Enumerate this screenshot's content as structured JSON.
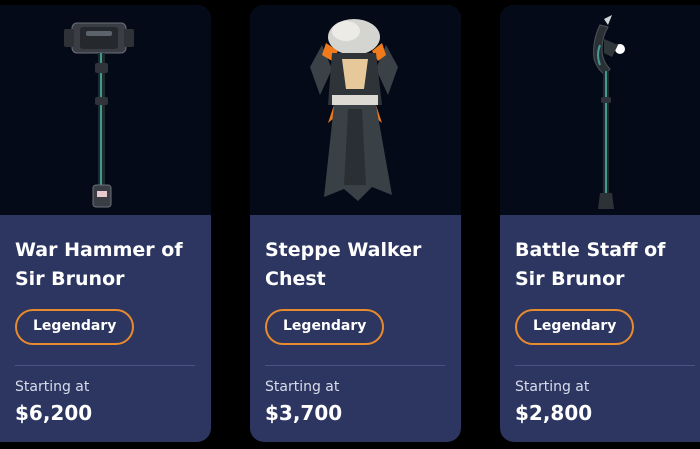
{
  "items": [
    {
      "name": "War Hammer of Sir Brunor",
      "rarity": "Legendary",
      "price_label": "Starting at",
      "price": "$6,200",
      "image_icon": "war-hammer-icon"
    },
    {
      "name": "Steppe Walker Chest",
      "rarity": "Legendary",
      "price_label": "Starting at",
      "price": "$3,700",
      "image_icon": "armor-chest-icon"
    },
    {
      "name": "Battle Staff of Sir Brunor",
      "rarity": "Legendary",
      "price_label": "Starting at",
      "price": "$2,800",
      "image_icon": "battle-staff-icon"
    }
  ],
  "colors": {
    "card_bg": "#2c3660",
    "image_bg": "#050a18",
    "rarity_border": "#e88a2e",
    "accent_orange": "#f07a1c"
  }
}
